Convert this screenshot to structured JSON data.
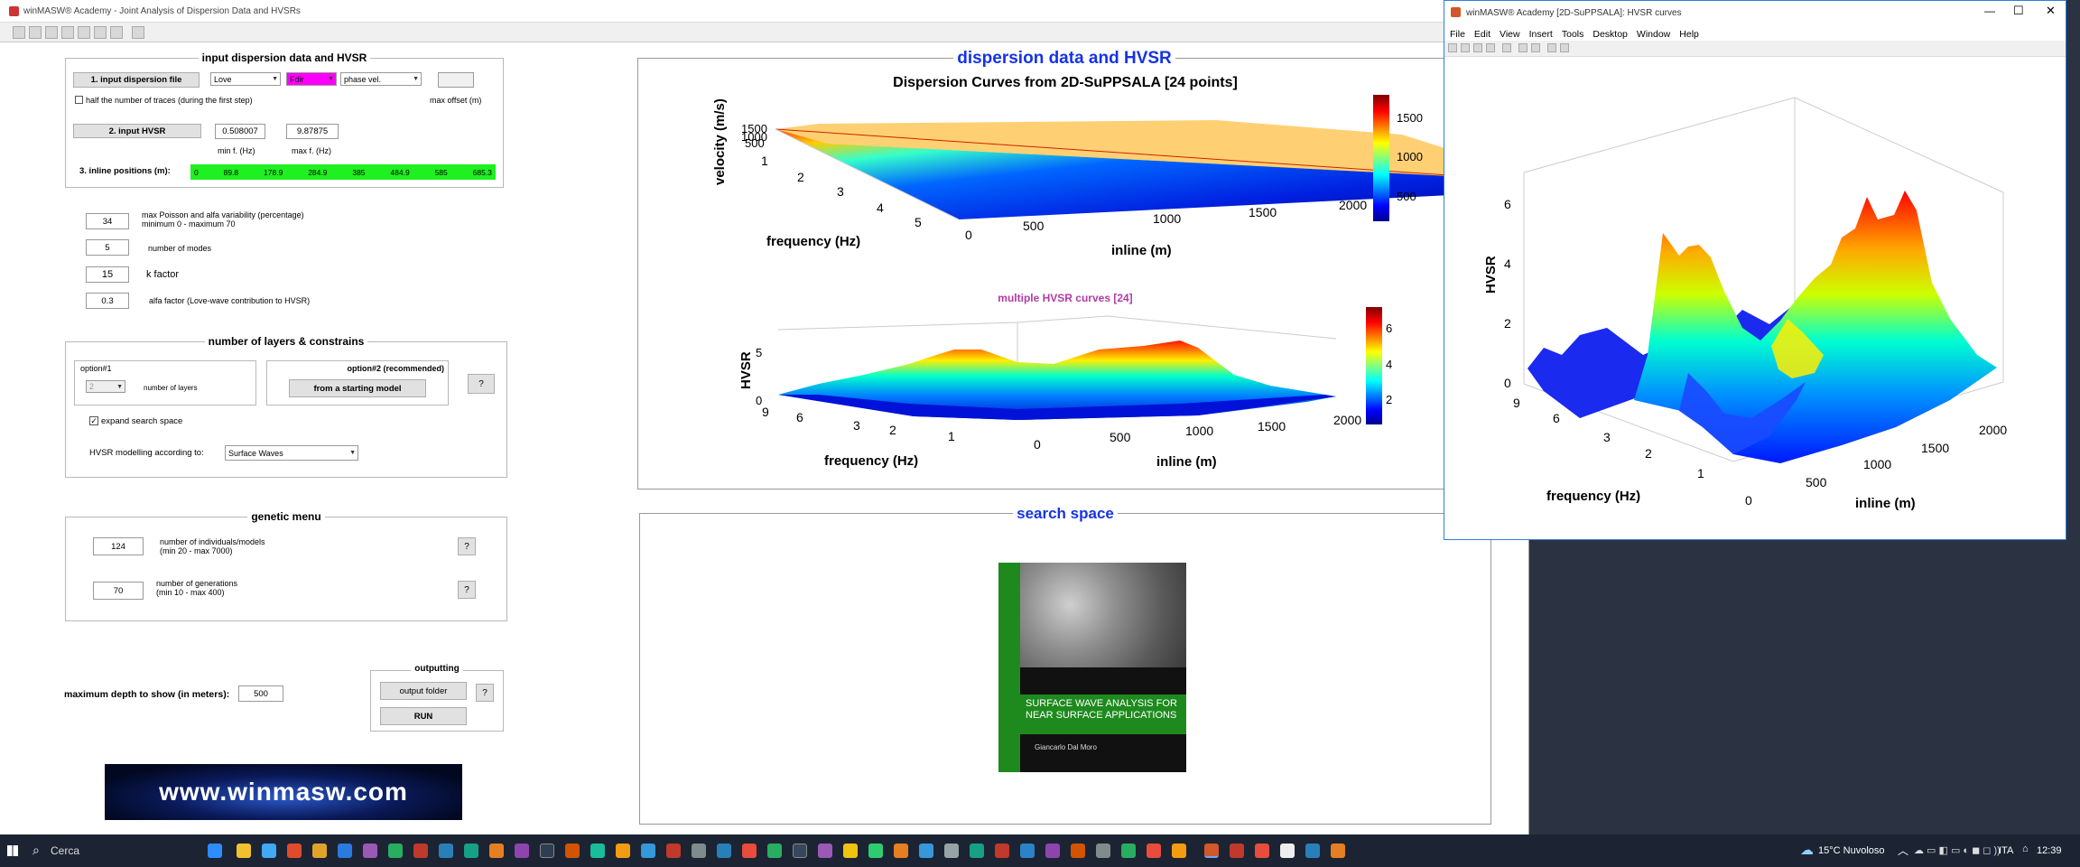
{
  "main": {
    "title": "winMASW® Academy - Joint Analysis of Dispersion Data and HVSRs",
    "input_panel": {
      "title": "input dispersion data and HVSR",
      "btn_dispersion": "1. input dispersion file",
      "wave_type": "Love",
      "data_type": "Fdir",
      "velocity_type": "phase vel.",
      "half_traces": "half the number of traces (during the first step)",
      "max_offset_label": "max offset (m)",
      "max_offset_value": "",
      "btn_hvsr": "2. input HVSR",
      "min_f": "0.508007",
      "max_f": "9.87875",
      "min_f_label": "min f. (Hz)",
      "max_f_label": "max f. (Hz)",
      "inline_label": "3. inline positions (m):",
      "inline_positions": [
        "0",
        "89.8",
        "178.9",
        "284.9",
        "385",
        "484.9",
        "585",
        "685.3"
      ]
    },
    "params": [
      {
        "value": "34",
        "label": "max Poisson and alfa variability (percentage)",
        "sub": "minimum 0 - maximum 70"
      },
      {
        "value": "5",
        "label": "number of modes",
        "sub": ""
      },
      {
        "value": "15",
        "label": "k factor",
        "sub": ""
      },
      {
        "value": "0.3",
        "label": "alfa factor (Love-wave contribution to HVSR)",
        "sub": ""
      }
    ],
    "layers_panel": {
      "title": "number of layers & constrains",
      "opt1": "option#1",
      "opt2": "option#2 (recommended)",
      "layers_value": "2",
      "layers_label": "number of layers",
      "btn_start": "from a starting model",
      "q": "?",
      "expand": "expand search space",
      "hvsr_label": "HVSR modelling according to:",
      "hvsr_mode": "Surface Waves"
    },
    "genetic_panel": {
      "title": "genetic menu",
      "individuals": "124",
      "individuals_label": "number of individuals/models",
      "individuals_sub": "(min 20 - max 7000)",
      "generations": "70",
      "generations_label": "number of generations",
      "generations_sub": "(min 10 - max 400)",
      "q": "?"
    },
    "depth_label": "maximum depth to show (in meters):",
    "depth_value": "500",
    "output_panel": {
      "title": "outputting",
      "btn_folder": "output folder",
      "btn_run": "RUN",
      "q": "?"
    },
    "logo": "www.winmasw.com",
    "right_top_title": "dispersion data and HVSR",
    "disp_plot": {
      "title": "Dispersion Curves from 2D-SuPPSALA [24 points]",
      "zlabel": "velocity (m/s)",
      "xlabel": "frequency (Hz)",
      "ylabel": "inline (m)",
      "zticks": [
        "500",
        "1000",
        "1500"
      ],
      "xticks": [
        "1",
        "2",
        "3",
        "4",
        "5"
      ],
      "yticks": [
        "0",
        "500",
        "1000",
        "1500",
        "2000"
      ],
      "cticks": [
        "1500",
        "1000",
        "500"
      ]
    },
    "hvsr_small": {
      "title": "multiple HVSR curves [24]",
      "zlabel": "HVSR",
      "xlabel": "frequency (Hz)",
      "ylabel": "inline (m)",
      "zticks": [
        "5",
        "0"
      ],
      "xticks": [
        "9",
        "6",
        "3",
        "2",
        "1"
      ],
      "yticks": [
        "0",
        "500",
        "1000",
        "1500",
        "2000"
      ],
      "cticks": [
        "6",
        "4",
        "2"
      ]
    },
    "search_title": "search space",
    "book": {
      "title": "SURFACE WAVE ANALYSIS FOR NEAR SURFACE APPLICATIONS",
      "author": "Giancarlo Dal Moro"
    }
  },
  "hwin": {
    "title": "winMASW® Academy [2D-SuPPSALA]: HVSR curves",
    "menu": [
      "File",
      "Edit",
      "View",
      "Insert",
      "Tools",
      "Desktop",
      "Window",
      "Help"
    ],
    "zlabel": "HVSR",
    "xlabel": "frequency (Hz)",
    "ylabel": "inline (m)",
    "zticks": [
      "6",
      "4",
      "2",
      "0"
    ],
    "xticks": [
      "9",
      "6",
      "3",
      "2",
      "1"
    ],
    "yticks": [
      "0",
      "500",
      "1000",
      "1500",
      "2000"
    ]
  },
  "taskbar": {
    "search": "Cerca",
    "weather": "15°C Nuvoloso",
    "lang": "ITA",
    "time": "12:39"
  }
}
